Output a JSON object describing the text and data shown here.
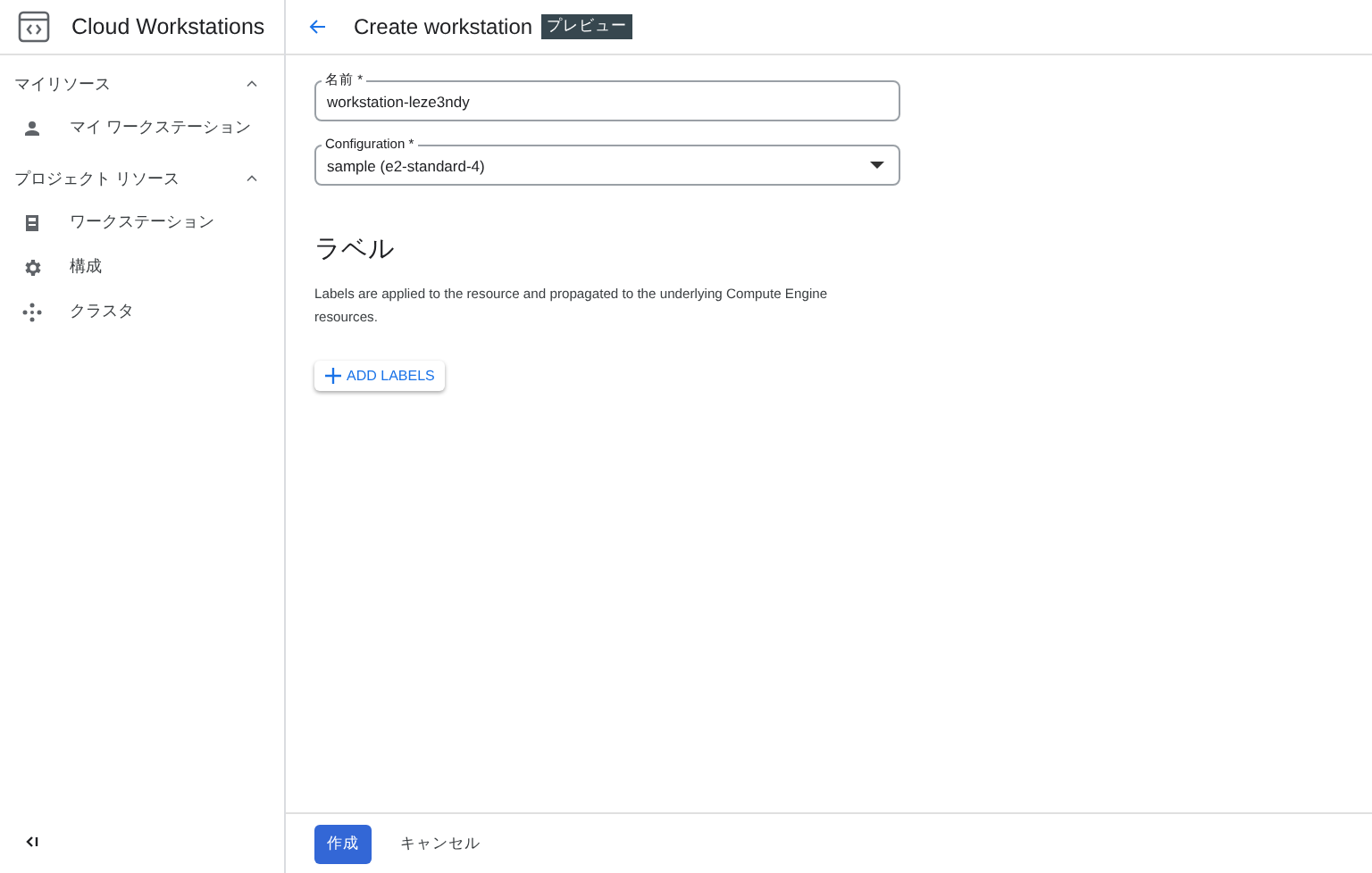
{
  "app": {
    "title": "Cloud Workstations"
  },
  "sidebar": {
    "sections": [
      {
        "title": "マイリソース",
        "expanded": true,
        "items": [
          {
            "label": "マイ ワークステーション",
            "kind": "person"
          }
        ]
      },
      {
        "title": "プロジェクト リソース",
        "expanded": true,
        "items": [
          {
            "label": "ワークステーション",
            "kind": "workstation"
          },
          {
            "label": "構成",
            "kind": "gear"
          },
          {
            "label": "クラスタ",
            "kind": "cluster"
          }
        ]
      }
    ]
  },
  "header": {
    "title": "Create workstation",
    "badge": "プレビュー"
  },
  "form": {
    "fields": [
      {
        "kind": "text",
        "label": "名前 *",
        "value": "workstation-leze3ndy"
      },
      {
        "kind": "select",
        "label": "Configuration *",
        "value": "sample (e2-standard-4)"
      }
    ],
    "section_title": "ラベル",
    "description": "Labels are applied to the resource and propagated to the underlying Compute Engine resources.",
    "add_button": "ADD LABELS"
  },
  "footer": {
    "primary": "作成",
    "secondary": "キャンセル"
  }
}
